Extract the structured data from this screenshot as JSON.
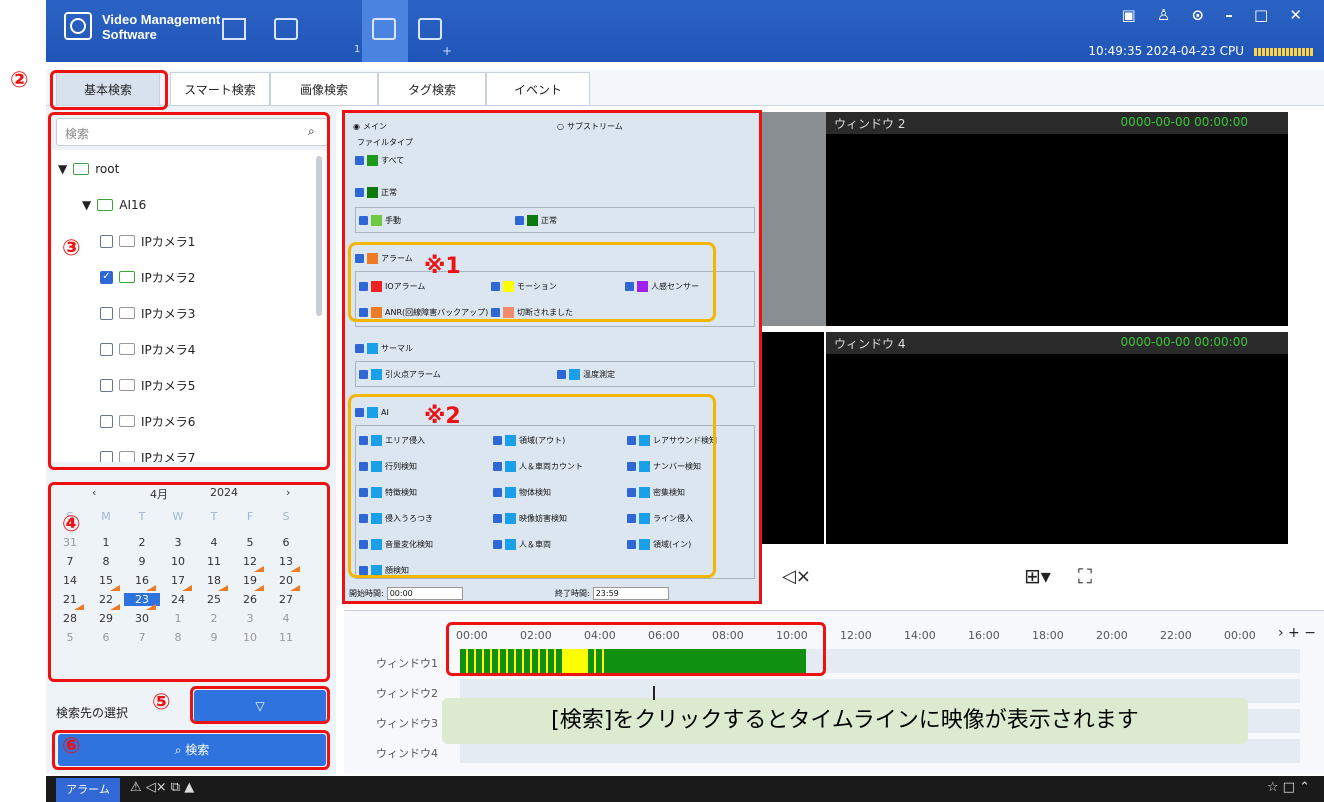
{
  "app": {
    "name": "Video Management\nSoftware",
    "clock": "10:49:35 2024-04-23 CPU",
    "nav_badge": "1",
    "nav_plus": "+"
  },
  "icons": [
    "home-icon",
    "monitor-icon",
    "camera-icon",
    "layout-icon"
  ],
  "tabs": [
    "基本検索",
    "スマート検索",
    "画像検索",
    "タグ検索",
    "イベント"
  ],
  "sidebar": {
    "search_placeholder": "検索",
    "tree": {
      "root": "root",
      "group": "AI16",
      "cameras": [
        "IPカメラ1",
        "IPカメラ2",
        "IPカメラ3",
        "IPカメラ4",
        "IPカメラ5",
        "IPカメラ6",
        "IPカメラ7"
      ],
      "checked": [
        false,
        true,
        false,
        false,
        false,
        false,
        false
      ]
    },
    "calendar": {
      "month": "4月",
      "year": "2024",
      "weekdays": [
        "S",
        "M",
        "T",
        "W",
        "T",
        "F",
        "S"
      ],
      "days": [
        [
          "31",
          "1",
          "2",
          "3",
          "4",
          "5",
          "6"
        ],
        [
          "7",
          "8",
          "9",
          "10",
          "11",
          "12",
          "13"
        ],
        [
          "14",
          "15",
          "16",
          "17",
          "18",
          "19",
          "20"
        ],
        [
          "21",
          "22",
          "23",
          "24",
          "25",
          "26",
          "27"
        ],
        [
          "28",
          "29",
          "30",
          "1",
          "2",
          "3",
          "4"
        ],
        [
          "5",
          "6",
          "7",
          "8",
          "9",
          "10",
          "11"
        ]
      ],
      "selected": "23"
    },
    "target_label": "検索先の選択",
    "search_button": "検索"
  },
  "filter": {
    "stream_main": "メイン",
    "stream_sub": "サブストリーム",
    "filetype": "ファイルタイプ",
    "all": "すべて",
    "normal": "正常",
    "manual": "手動",
    "normal2": "正常",
    "alarm": "アラーム",
    "io": "IOアラーム",
    "motion": "モーション",
    "human": "人感センサー",
    "anr": "ANR(回線障害バックアップ)",
    "disconnect": "切断されました",
    "thermal": "サーマル",
    "fire": "引火点アラーム",
    "temp": "温度測定",
    "ai": "AI",
    "ai_items": [
      "エリア侵入",
      "領域(アウト)",
      "レアサウンド検知",
      "行列検知",
      "人＆車両カウント",
      "ナンバー検知",
      "特徴検知",
      "物体検知",
      "密集検知",
      "侵入うろつき",
      "映像妨害検知",
      "ライン侵入",
      "音量変化検知",
      "人＆車両",
      "領域(イン)",
      "顔検知"
    ],
    "start_label": "開始時間:",
    "start": "00:00",
    "end_label": "終了時間:",
    "end": "23:59"
  },
  "windows": [
    {
      "name": "ウィンドウ 2",
      "time": "0000-00-00 00:00:00"
    },
    {
      "name": "ウィンドウ 4",
      "time": "0000-00-00 00:00:00"
    }
  ],
  "timeline": {
    "ticks": [
      "00:00",
      "02:00",
      "04:00",
      "06:00",
      "08:00",
      "10:00",
      "12:00",
      "14:00",
      "16:00",
      "18:00",
      "20:00",
      "22:00",
      "00:00"
    ],
    "rows": [
      "ウィンドウ1",
      "ウィンドウ2",
      "ウィンドウ3",
      "ウィンドウ4"
    ]
  },
  "bottom": {
    "alarm": "アラーム"
  },
  "annotations": {
    "n2": "②",
    "n3": "③",
    "n4": "④",
    "n5": "⑤",
    "n6": "⑥",
    "m1": "※1",
    "m2": "※2",
    "callout": "[検索]をクリックするとタイムラインに映像が表示されます"
  },
  "colors": {
    "accent": "#2f74de",
    "alarm": "#ef7a25",
    "green": "#109010",
    "highlight": "#e11"
  }
}
